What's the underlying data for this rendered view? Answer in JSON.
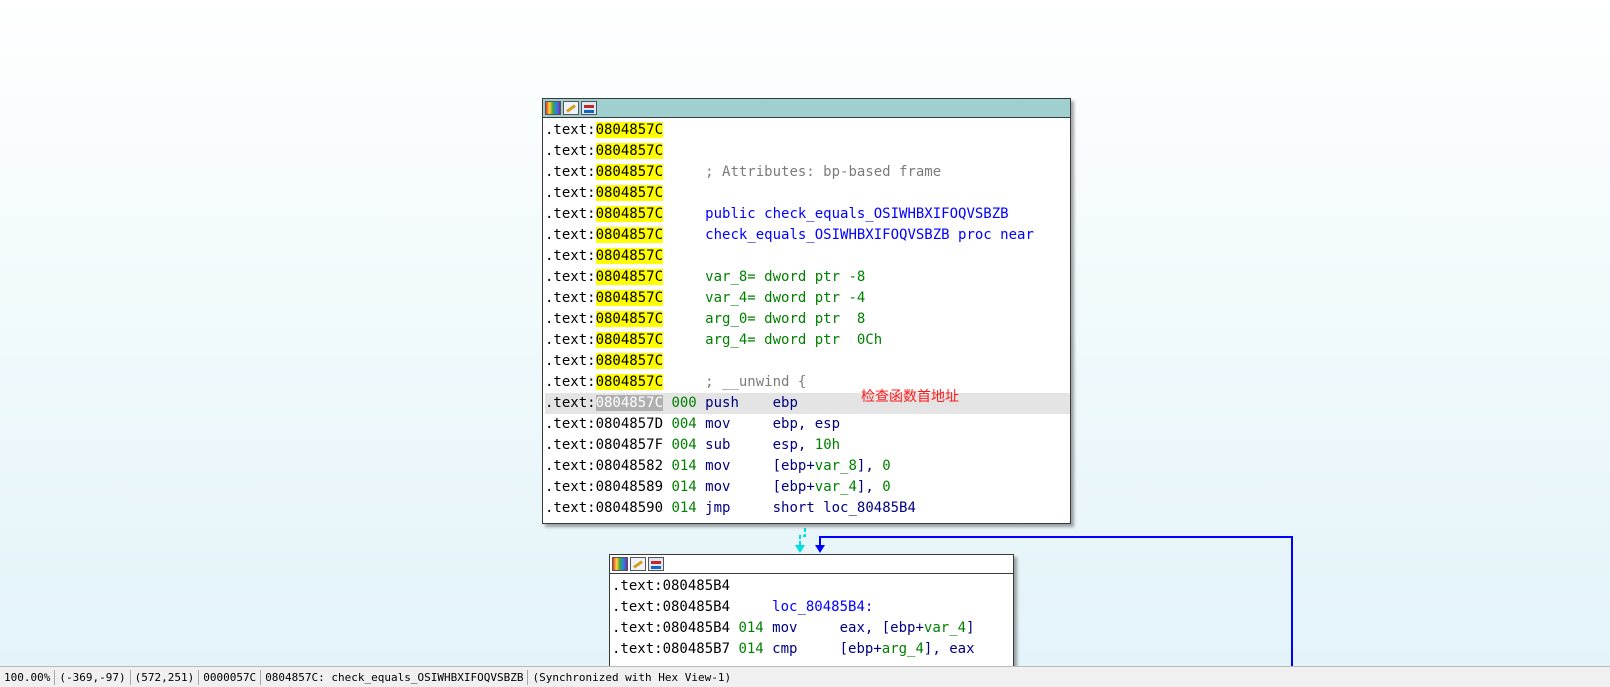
{
  "node1": {
    "lines": [
      {
        "seg": ".text:",
        "addr": "0804857C",
        "rest": ""
      },
      {
        "seg": ".text:",
        "addr": "0804857C",
        "rest": ""
      },
      {
        "seg": ".text:",
        "addr": "0804857C",
        "rest": "     ; Attributes: bp-based frame"
      },
      {
        "seg": ".text:",
        "addr": "0804857C",
        "rest": ""
      },
      {
        "seg": ".text:",
        "addr": "0804857C",
        "rest": "     public check_equals_OSIWHBXIFOQVSBZB"
      },
      {
        "seg": ".text:",
        "addr": "0804857C",
        "rest": "     check_equals_OSIWHBXIFOQVSBZB proc near"
      },
      {
        "seg": ".text:",
        "addr": "0804857C",
        "rest": ""
      },
      {
        "seg": ".text:",
        "addr": "0804857C",
        "rest": "     var_8= dword ptr -8"
      },
      {
        "seg": ".text:",
        "addr": "0804857C",
        "rest": "     var_4= dword ptr -4"
      },
      {
        "seg": ".text:",
        "addr": "0804857C",
        "rest": "     arg_0= dword ptr  8"
      },
      {
        "seg": ".text:",
        "addr": "0804857C",
        "rest": "     arg_4= dword ptr  0Ch"
      },
      {
        "seg": ".text:",
        "addr": "0804857C",
        "rest": ""
      },
      {
        "seg": ".text:",
        "addr": "0804857C",
        "rest": "     ; __unwind {"
      },
      {
        "seg": ".text:",
        "addr": "0804857C",
        "sp": "000",
        "mnem": "push",
        "ops": "ebp"
      },
      {
        "seg": ".text:",
        "addr": "0804857D",
        "sp": "004",
        "mnem": "mov",
        "ops": "ebp, esp"
      },
      {
        "seg": ".text:",
        "addr": "0804857F",
        "sp": "004",
        "mnem": "sub",
        "ops": "esp, 10h"
      },
      {
        "seg": ".text:",
        "addr": "08048582",
        "sp": "014",
        "mnem": "mov",
        "ops": "[ebp+var_8], 0"
      },
      {
        "seg": ".text:",
        "addr": "08048589",
        "sp": "014",
        "mnem": "mov",
        "ops": "[ebp+var_4], 0"
      },
      {
        "seg": ".text:",
        "addr": "08048590",
        "sp": "014",
        "mnem": "jmp",
        "ops": "short loc_80485B4"
      }
    ],
    "annotation": "检查函数首地址"
  },
  "node2": {
    "lines": [
      {
        "seg": ".text:",
        "addr": "080485B4",
        "rest": ""
      },
      {
        "seg": ".text:",
        "addr": "080485B4",
        "rest": "     loc_80485B4:"
      },
      {
        "seg": ".text:",
        "addr": "080485B4",
        "sp": "014",
        "mnem": "mov",
        "ops": "eax, [ebp+var_4]"
      },
      {
        "seg": ".text:",
        "addr": "080485B7",
        "sp": "014",
        "mnem": "cmp",
        "ops": "[ebp+arg_4], eax"
      }
    ]
  },
  "status": {
    "zoom": "100.00%",
    "mouse": "(-369,-97)",
    "graph_pos": "(572,251)",
    "offset": "0000057C",
    "location": "0804857C: check_equals_OSIWHBXIFOQVSBZB",
    "sync": "(Synchronized with Hex View-1)"
  }
}
